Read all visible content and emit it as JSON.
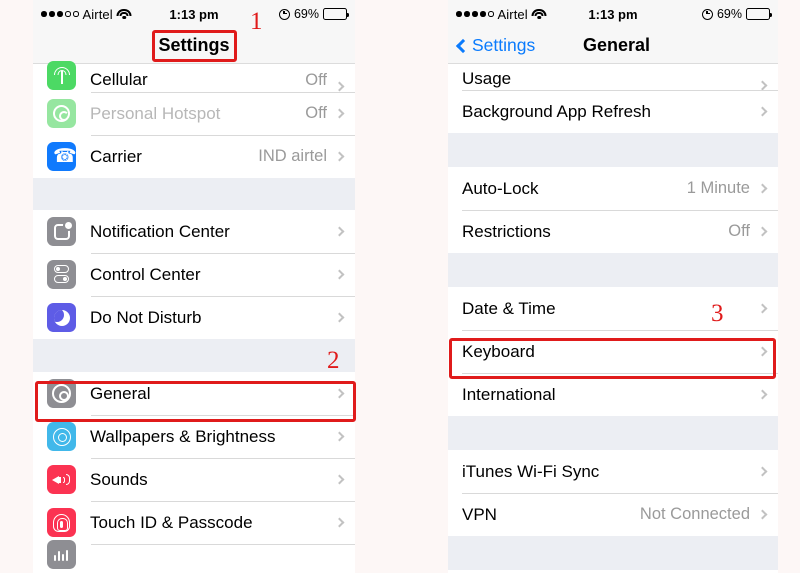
{
  "background_color": "#fdf7f6",
  "accent_blue": "#0a7bfd",
  "annotation_color": "#e01b1b",
  "left_phone": {
    "status_bar": {
      "signal_filled": 3,
      "signal_hollow": 2,
      "carrier": "Airtel",
      "wifi_icon": "wifi-icon",
      "time": "1:13 pm",
      "alarm_icon": "alarm-icon",
      "battery_percent": "69%",
      "battery_level": 69
    },
    "nav": {
      "title": "Settings"
    },
    "groups": [
      {
        "rows": [
          {
            "icon": "cellular-icon",
            "icon_class": "g-cell",
            "art": "tower",
            "label": "Cellular",
            "muted": false,
            "value": "Off",
            "chevron": true
          },
          {
            "icon": "personal-hotspot-icon",
            "icon_class": "g-hot",
            "art": "hotspot",
            "label": "Personal Hotspot",
            "muted": true,
            "value": "Off",
            "chevron": true
          },
          {
            "icon": "carrier-icon",
            "icon_class": "g-phone",
            "art": "phone",
            "label": "Carrier",
            "muted": false,
            "value": "IND airtel",
            "chevron": true
          }
        ]
      },
      {
        "rows": [
          {
            "icon": "notification-center-icon",
            "icon_class": "g-notif",
            "art": "notif",
            "label": "Notification Center",
            "muted": false,
            "value": "",
            "chevron": true
          },
          {
            "icon": "control-center-icon",
            "icon_class": "g-ctrl",
            "art": "control",
            "label": "Control Center",
            "muted": false,
            "value": "",
            "chevron": true
          },
          {
            "icon": "do-not-disturb-icon",
            "icon_class": "g-dnd",
            "art": "moon",
            "label": "Do Not Disturb",
            "muted": false,
            "value": "",
            "chevron": true
          }
        ]
      },
      {
        "rows": [
          {
            "icon": "general-icon",
            "icon_class": "g-gen",
            "art": "gear",
            "label": "General",
            "muted": false,
            "value": "",
            "chevron": true
          },
          {
            "icon": "wallpapers-icon",
            "icon_class": "g-wall",
            "art": "wallpaper",
            "label": "Wallpapers & Brightness",
            "muted": false,
            "value": "",
            "chevron": true
          },
          {
            "icon": "sounds-icon",
            "icon_class": "g-snd",
            "art": "speaker",
            "label": "Sounds",
            "muted": false,
            "value": "",
            "chevron": true
          },
          {
            "icon": "touch-id-icon",
            "icon_class": "g-touch",
            "art": "fingerprint",
            "label": "Touch ID & Passcode",
            "muted": false,
            "value": "",
            "chevron": true
          },
          {
            "icon": "privacy-icon",
            "icon_class": "g-part",
            "art": "bars",
            "label": "",
            "muted": false,
            "value": "",
            "chevron": false
          }
        ]
      }
    ]
  },
  "right_phone": {
    "status_bar": {
      "signal_filled": 4,
      "signal_hollow": 1,
      "carrier": "Airtel",
      "wifi_icon": "wifi-icon",
      "time": "1:13 pm",
      "alarm_icon": "alarm-icon",
      "battery_percent": "69%",
      "battery_level": 69
    },
    "nav": {
      "back_label": "Settings",
      "title": "General"
    },
    "groups": [
      {
        "rows": [
          {
            "label": "Usage",
            "value": "",
            "chevron": true
          },
          {
            "label": "Background App Refresh",
            "value": "",
            "chevron": true
          }
        ]
      },
      {
        "rows": [
          {
            "label": "Auto-Lock",
            "value": "1 Minute",
            "chevron": true
          },
          {
            "label": "Restrictions",
            "value": "Off",
            "chevron": true
          }
        ]
      },
      {
        "rows": [
          {
            "label": "Date & Time",
            "value": "",
            "chevron": true
          },
          {
            "label": "Keyboard",
            "value": "",
            "chevron": true
          },
          {
            "label": "International",
            "value": "",
            "chevron": true
          }
        ]
      },
      {
        "rows": [
          {
            "label": "iTunes Wi-Fi Sync",
            "value": "",
            "chevron": true
          },
          {
            "label": "VPN",
            "value": "Not Connected",
            "chevron": true
          }
        ]
      }
    ]
  },
  "annotations": {
    "step1": "1",
    "step2": "2",
    "step3": "3"
  }
}
